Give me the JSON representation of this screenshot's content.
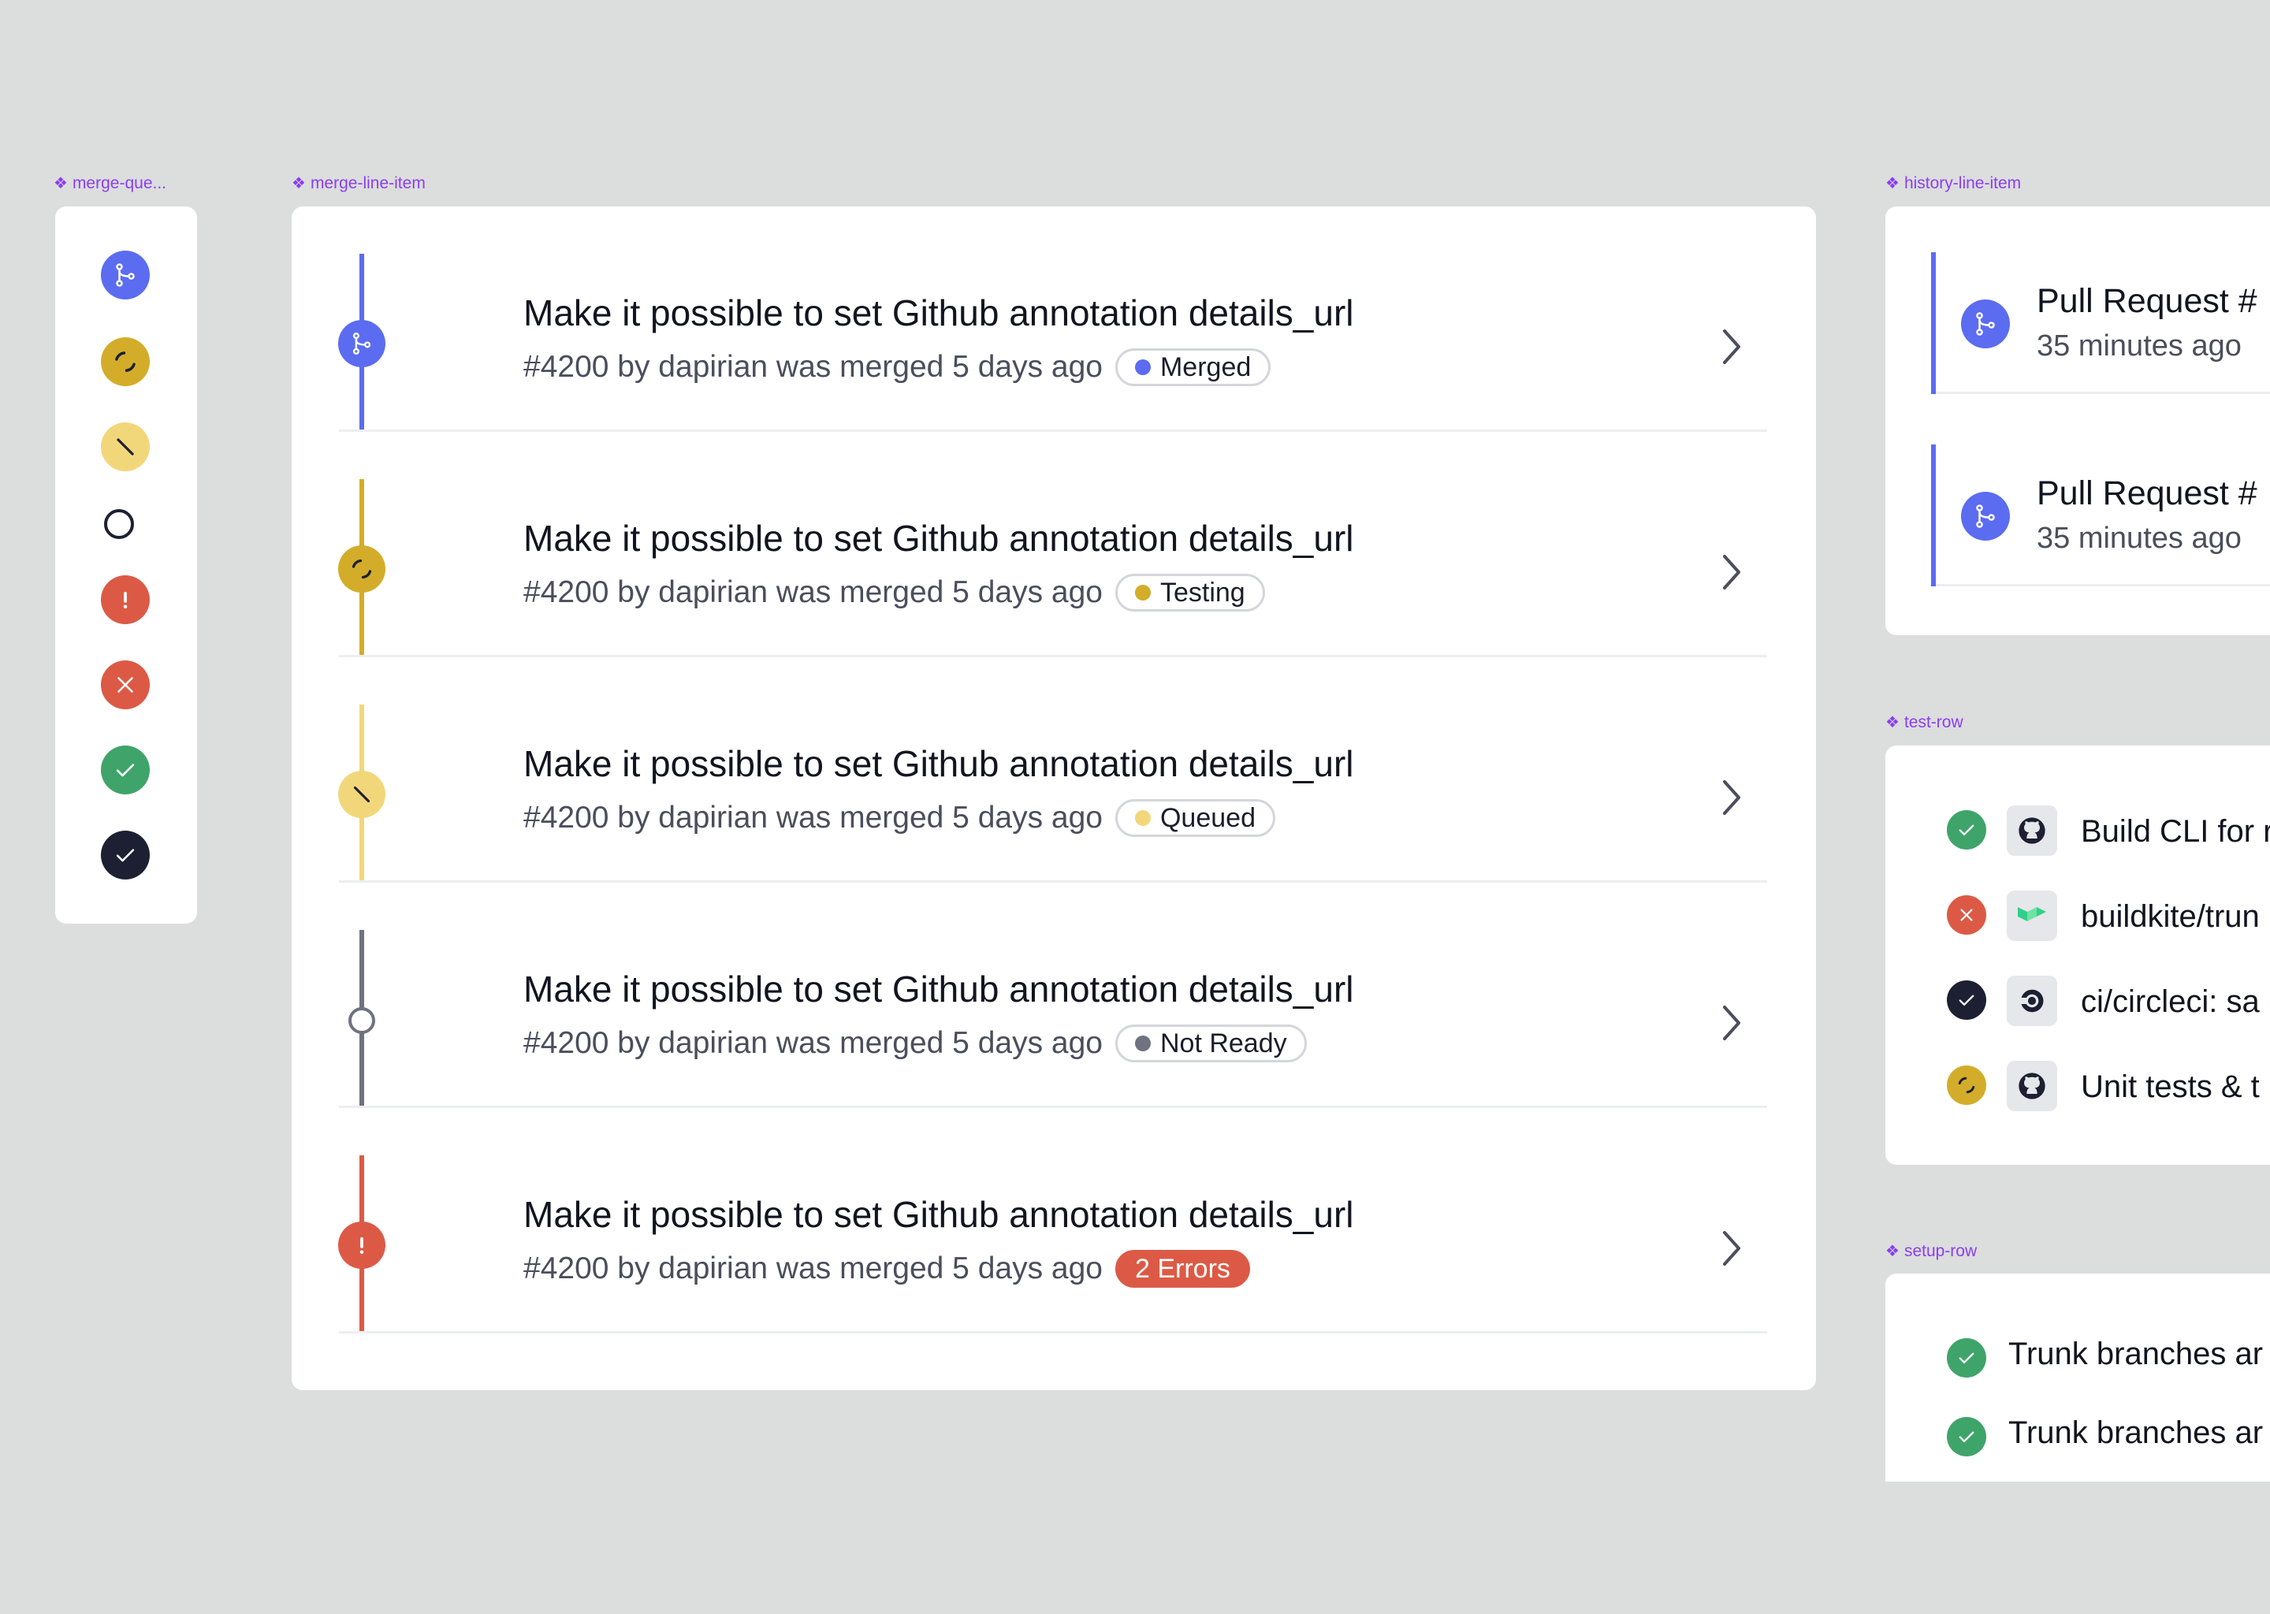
{
  "frames": {
    "merge_queue_icons": "merge-que...",
    "merge_line_item": "merge-line-item",
    "history_line_item": "history-line-item",
    "test_row": "test-row",
    "setup_row": "setup-row"
  },
  "colors": {
    "merged": "#5b6cf0",
    "testing": "#d3ad2a",
    "queued": "#f2d77a",
    "not_ready": "#6f7280",
    "error": "#dc5a45",
    "success": "#3fa46a",
    "dark": "#1d2033",
    "label": "#8a3ff0"
  },
  "icon_column": [
    "merge-icon",
    "testing-icon",
    "queued-icon",
    "not-ready-icon",
    "error-icon",
    "failed-icon",
    "success-icon",
    "dark-check-icon"
  ],
  "merge_items": [
    {
      "title": "Make it possible to set Github annotation details_url",
      "meta": "#4200 by dapirian was merged 5 days ago",
      "status": "Merged"
    },
    {
      "title": "Make it possible to set Github annotation details_url",
      "meta": "#4200 by dapirian was merged 5 days ago",
      "status": "Testing"
    },
    {
      "title": "Make it possible to set Github annotation details_url",
      "meta": "#4200 by dapirian was merged 5 days ago",
      "status": "Queued"
    },
    {
      "title": "Make it possible to set Github annotation details_url",
      "meta": "#4200 by dapirian was merged 5 days ago",
      "status": "Not Ready"
    },
    {
      "title": "Make it possible to set Github annotation details_url",
      "meta": "#4200 by dapirian was merged 5 days ago",
      "status": "2 Errors"
    }
  ],
  "history_items": [
    {
      "title": "Pull Request #",
      "time": "35 minutes ago"
    },
    {
      "title": "Pull Request #",
      "time": "35 minutes ago"
    }
  ],
  "test_rows": [
    {
      "status": "success",
      "logo": "github-icon",
      "text": "Build CLI for r"
    },
    {
      "status": "failed",
      "logo": "buildkite-icon",
      "text": "buildkite/trun"
    },
    {
      "status": "dark-success",
      "logo": "circleci-icon",
      "text": "ci/circleci: sa"
    },
    {
      "status": "testing",
      "logo": "github-icon",
      "text": "Unit tests & t"
    }
  ],
  "setup_rows": [
    {
      "status": "success",
      "text": "Trunk branches ar"
    },
    {
      "status": "success",
      "text": "Trunk branches ar"
    }
  ]
}
